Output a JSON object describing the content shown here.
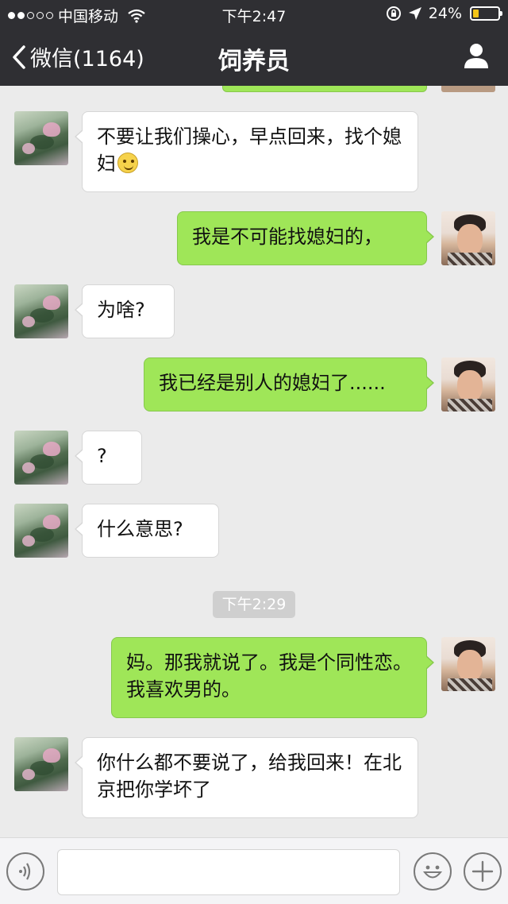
{
  "status_bar": {
    "carrier": "中国移动",
    "time": "下午2:47",
    "battery": "24%",
    "battery_level": 0.24,
    "battery_color": "#f5c518"
  },
  "nav": {
    "back_label": "微信(1164)",
    "title": "饲养员",
    "profile_icon": "person-icon"
  },
  "messages": [
    {
      "side": "left",
      "sender": "mom",
      "text": "不要让我们操心，早点回来，找个媳妇",
      "emoji": "smile-emoji"
    },
    {
      "side": "right",
      "sender": "son",
      "text": "我是不可能找媳妇的，"
    },
    {
      "side": "left",
      "sender": "mom",
      "text": "为啥?"
    },
    {
      "side": "right",
      "sender": "son",
      "text": "我已经是别人的媳妇了......"
    },
    {
      "side": "left",
      "sender": "mom",
      "text": "?"
    },
    {
      "side": "left",
      "sender": "mom",
      "text": "什么意思?"
    },
    {
      "type": "timestamp",
      "text": "下午2:29"
    },
    {
      "side": "right",
      "sender": "son",
      "text": "妈。那我就说了。我是个同性恋。我喜欢男的。"
    },
    {
      "side": "left",
      "sender": "mom",
      "text": "你什么都不要说了，给我回来！在北京把你学坏了"
    }
  ],
  "input_bar": {
    "voice_icon": "voice-icon",
    "emoji_icon": "emoji-icon",
    "more_icon": "plus-icon",
    "input_value": ""
  },
  "colors": {
    "nav_background": "#2f2f33",
    "chat_background": "#ebebeb",
    "outgoing_bubble": "#9fe658",
    "incoming_bubble": "#ffffff"
  }
}
